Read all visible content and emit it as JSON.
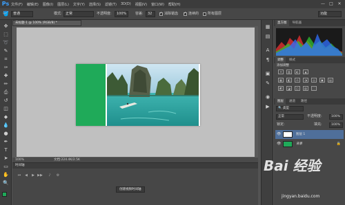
{
  "app": {
    "logo": "Ps"
  },
  "menu": [
    "文件(F)",
    "编辑(E)",
    "图像(I)",
    "图层(L)",
    "文字(Y)",
    "选择(S)",
    "滤镜(T)",
    "3D(D)",
    "视图(V)",
    "窗口(W)",
    "帮助(H)"
  ],
  "window_controls": [
    "—",
    "□",
    "✕"
  ],
  "options": {
    "mode_value": "普通",
    "style_label": "模式:",
    "style_value": "正常",
    "opacity_label": "不透明度:",
    "opacity_value": "100%",
    "tolerance_label": "容差:",
    "tolerance_value": "32",
    "antialias_label": "消除锯齿",
    "contiguous_label": "连续的",
    "all_layers_label": "所有图层",
    "workspace_value": "功能"
  },
  "document": {
    "tab_title": "未标题-1 @ 100% (RGB/8) *",
    "status": "文档:224.4K/2.5K"
  },
  "timeline": {
    "header": "时间轴",
    "create_button": "创建视频时间轴"
  },
  "panels": {
    "histogram_tabs": [
      "直方图",
      "导航器"
    ],
    "adjustments_tabs": [
      "调整",
      "样式"
    ],
    "adjustments_title": "添加调整",
    "adjustment_icons": [
      "☀",
      "▥",
      "◐",
      "▲",
      "▦",
      "◧",
      "⚖",
      "◑",
      "◎",
      "▣",
      "▤",
      "◩",
      "◪",
      "◫",
      "▧",
      "⬚"
    ],
    "layers_tabs": [
      "图层",
      "通道",
      "路径"
    ],
    "kind_value": "类型",
    "blend_value": "正常",
    "opacity_label": "不透明度:",
    "opacity_value": "100%",
    "lock_label": "锁定:",
    "fill_label": "填充:",
    "fill_value": "100%",
    "layers": [
      {
        "name": "图层 1",
        "selected": true
      },
      {
        "name": "背景",
        "selected": false
      }
    ]
  },
  "watermark": {
    "text": "Bai 经验",
    "url": "jingyan.baidu.com"
  },
  "colors": {
    "accent_green": "#1faa59",
    "selection": "#4f6f9a"
  }
}
